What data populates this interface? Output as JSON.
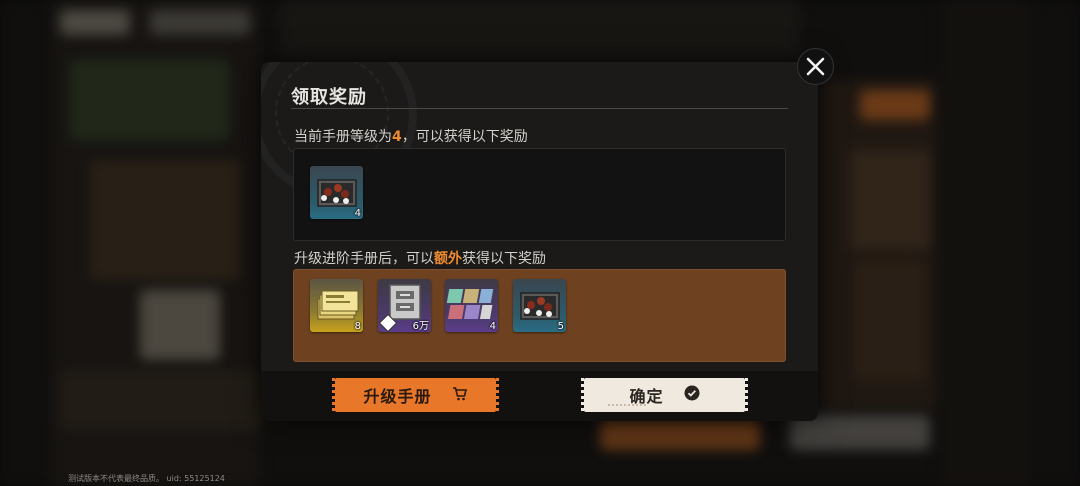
{
  "dialog": {
    "title": "领取奖励",
    "current_section": {
      "prefix": "当前手册等级为",
      "level": "4",
      "suffix": "，可以获得以下奖励",
      "items": [
        {
          "name": "gear-chest-icon",
          "qty": "4",
          "rarity_color": "#2a6d84"
        }
      ]
    },
    "upgrade_section": {
      "prefix": "升级进阶手册后，可以",
      "highlight": "额外",
      "suffix": "获得以下奖励",
      "items": [
        {
          "name": "gold-ticket-stack-icon",
          "qty": "8",
          "rarity_color": "#c8a21c"
        },
        {
          "name": "silver-plate-currency-icon",
          "qty": "6万",
          "rarity_color": "#5a3d8a"
        },
        {
          "name": "color-chips-icon",
          "qty": "4",
          "rarity_color": "#5a3d8a"
        },
        {
          "name": "gear-chest-icon",
          "qty": "5",
          "rarity_color": "#2a6d84"
        }
      ]
    },
    "buttons": {
      "upgrade_label": "升级手册",
      "confirm_label": "确定"
    }
  },
  "footer": {
    "text": "测试版本不代表最终品质。 uid: 55125124"
  },
  "colors": {
    "accent_orange": "#e8772a",
    "highlight_text": "#f08a2e",
    "panel_brown": "#6e4220"
  }
}
